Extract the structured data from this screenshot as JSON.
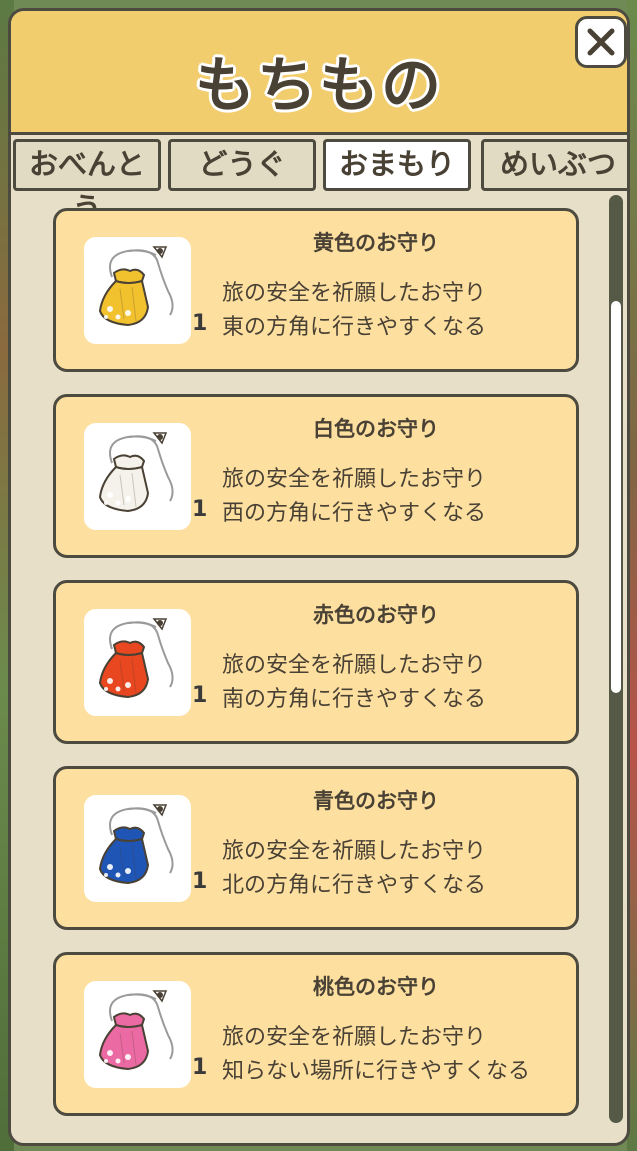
{
  "header": {
    "title": "もちもの"
  },
  "tabs": [
    {
      "label": "おべんとう",
      "active": false
    },
    {
      "label": "どうぐ",
      "active": false
    },
    {
      "label": "おまもり",
      "active": true
    },
    {
      "label": "めいぶつ",
      "active": false
    }
  ],
  "items": [
    {
      "name": "黄色のお守り",
      "desc1": "旅の安全を祈願したお守り",
      "desc2": "東の方角に行きやすくなる",
      "qty": "1",
      "color": "#f2c12e"
    },
    {
      "name": "白色のお守り",
      "desc1": "旅の安全を祈願したお守り",
      "desc2": "西の方角に行きやすくなる",
      "qty": "1",
      "color": "#f4f2ea"
    },
    {
      "name": "赤色のお守り",
      "desc1": "旅の安全を祈願したお守り",
      "desc2": "南の方角に行きやすくなる",
      "qty": "1",
      "color": "#e8471f"
    },
    {
      "name": "青色のお守り",
      "desc1": "旅の安全を祈願したお守り",
      "desc2": "北の方角に行きやすくなる",
      "qty": "1",
      "color": "#1f55b4"
    },
    {
      "name": "桃色のお守り",
      "desc1": "旅の安全を祈願したお守り",
      "desc2": "知らない場所に行きやすくなる",
      "qty": "1",
      "color": "#ec6aa3"
    }
  ],
  "icons": {
    "close": "close-icon",
    "charm": "omamori-charm-icon"
  },
  "colors": {
    "header_bg": "#f2cd6e",
    "card_bg": "#fde0a0",
    "panel_bg": "#e8dfc8",
    "border": "#4d4a3f"
  }
}
